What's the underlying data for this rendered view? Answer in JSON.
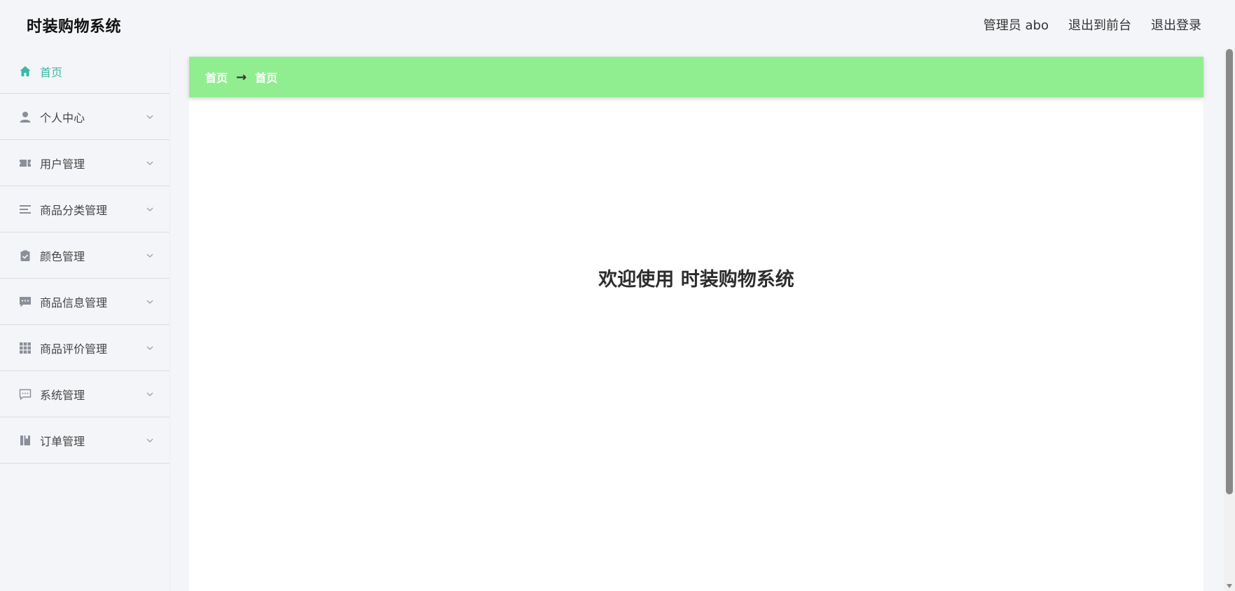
{
  "header": {
    "app_title": "时装购物系统",
    "admin_label": "管理员 abo",
    "front_link": "退出到前台",
    "logout_link": "退出登录"
  },
  "sidebar": {
    "items": [
      {
        "label": "首页",
        "icon": "home-icon"
      },
      {
        "label": "个人中心",
        "icon": "user-icon"
      },
      {
        "label": "用户管理",
        "icon": "ticket-icon"
      },
      {
        "label": "商品分类管理",
        "icon": "list-icon"
      },
      {
        "label": "颜色管理",
        "icon": "clipboard-check-icon"
      },
      {
        "label": "商品信息管理",
        "icon": "message-icon"
      },
      {
        "label": "商品评价管理",
        "icon": "grid-icon"
      },
      {
        "label": "系统管理",
        "icon": "chat-dots-icon"
      },
      {
        "label": "订单管理",
        "icon": "book-icon"
      }
    ]
  },
  "breadcrumb": {
    "home": "首页",
    "separator": "→",
    "current": "首页"
  },
  "main": {
    "welcome": "欢迎使用 时装购物系统"
  },
  "colors": {
    "accent": "#3bb8a6",
    "breadcrumb_bg": "#90ee90",
    "icon_gray": "#8a8f99"
  }
}
